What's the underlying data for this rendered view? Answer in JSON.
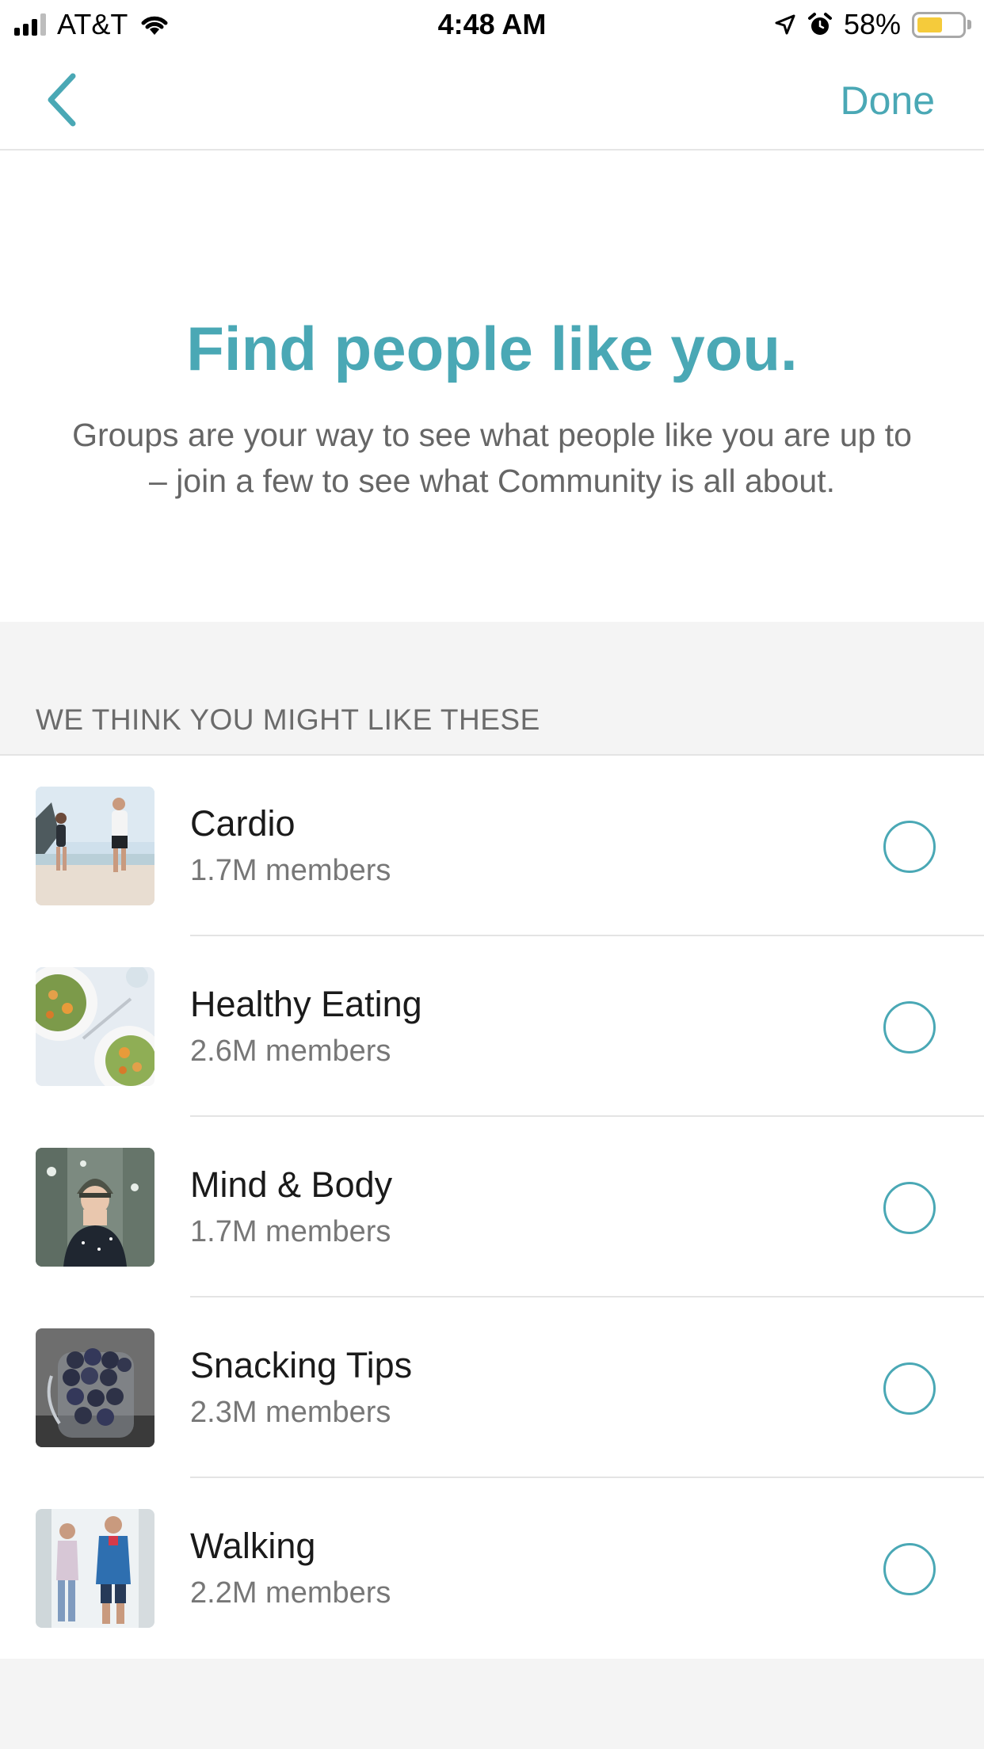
{
  "status_bar": {
    "carrier": "AT&T",
    "time": "4:48 AM",
    "battery_percent": "58%",
    "battery_level": 0.58,
    "battery_color": "#f5cb3b",
    "icons": [
      "signal-icon",
      "wifi-icon",
      "location-arrow-icon",
      "alarm-icon",
      "battery-icon"
    ]
  },
  "nav": {
    "back_icon": "chevron-left-icon",
    "done_label": "Done"
  },
  "hero": {
    "title": "Find people like you.",
    "description": "Groups are your way to see what people like you are up to – join a few to see what Community is all about."
  },
  "section": {
    "header": "WE THINK YOU MIGHT LIKE THESE"
  },
  "groups": [
    {
      "name": "Cardio",
      "members": "1.7M members",
      "selected": false,
      "image": "runners-on-beach"
    },
    {
      "name": "Healthy Eating",
      "members": "2.6M members",
      "selected": false,
      "image": "salad-plates"
    },
    {
      "name": "Mind & Body",
      "members": "1.7M members",
      "selected": false,
      "image": "woman-in-winter-hat"
    },
    {
      "name": "Snacking Tips",
      "members": "2.3M members",
      "selected": false,
      "image": "jar-of-blueberries"
    },
    {
      "name": "Walking",
      "members": "2.2M members",
      "selected": false,
      "image": "couple-walking"
    }
  ],
  "colors": {
    "accent": "#4aa8b5",
    "section_background": "#f4f4f4",
    "divider": "#e4e4e4",
    "secondary_text": "#777777"
  }
}
